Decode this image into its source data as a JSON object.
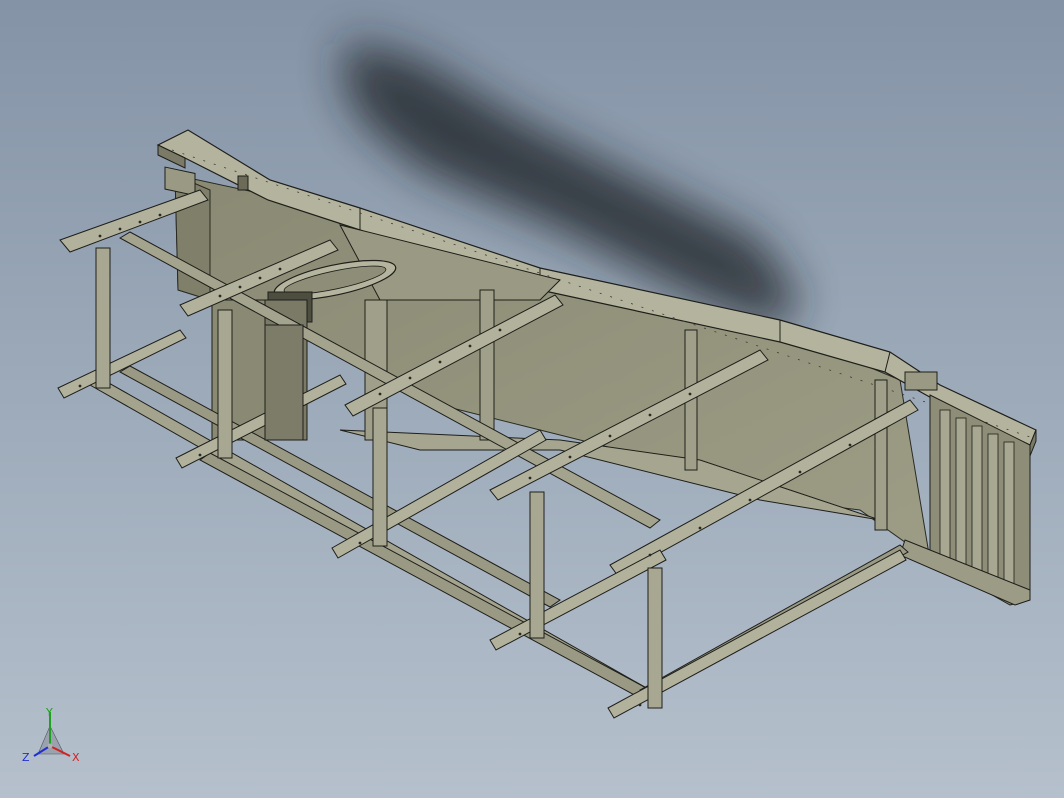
{
  "viewport": {
    "background_top": "#8493a6",
    "background_bottom": "#b5c0cc"
  },
  "model": {
    "face_color": "#8f8f7a",
    "dark_face_color": "#6d6d5c",
    "light_face_color": "#b0b09a",
    "edge_color": "#1e1e1a",
    "shadow_color": "#1a1d24"
  },
  "triad": {
    "x_label": "X",
    "y_label": "Y",
    "z_label": "Z",
    "x_color": "#d42020",
    "y_color": "#20a020",
    "z_color": "#2030d0"
  }
}
